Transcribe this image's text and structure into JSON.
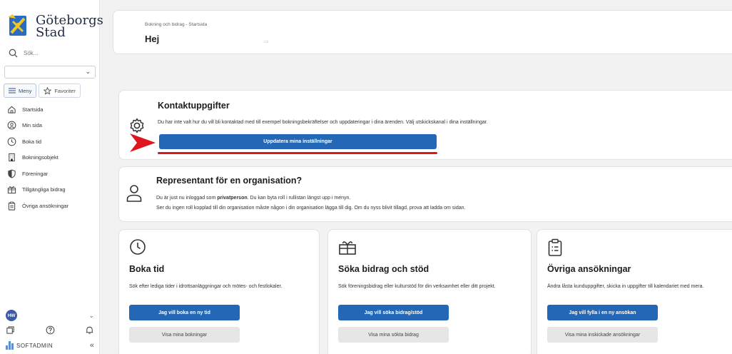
{
  "sidebar": {
    "logo_line1": "Göteborgs",
    "logo_line2": "Stad",
    "search_placeholder": "Sök...",
    "tabs": [
      {
        "label": "Meny",
        "icon": "menu-icon"
      },
      {
        "label": "Favoriter",
        "icon": "star-icon"
      }
    ],
    "items": [
      {
        "label": "Startsida",
        "icon": "home-icon"
      },
      {
        "label": "Min sida",
        "icon": "user-circle-icon"
      },
      {
        "label": "Boka tid",
        "icon": "clock-icon"
      },
      {
        "label": "Bokningsobjekt",
        "icon": "building-icon"
      },
      {
        "label": "Föreningar",
        "icon": "shield-icon"
      },
      {
        "label": "Tillgängliga bidrag",
        "icon": "gift-icon"
      },
      {
        "label": "Övriga ansökningar",
        "icon": "clipboard-icon"
      }
    ],
    "avatar_initials": "HW",
    "brand": "SOFTADMIN"
  },
  "header": {
    "breadcrumb": "Bokning och bidrag - Startsida",
    "greeting": "Hej"
  },
  "contact": {
    "title": "Kontaktuppgifter",
    "text": "Du har inte valt hur du vill bli kontaktad med till exempel bokningsbekräftelser och uppdateringar i dina ärenden. Välj utskickskanal i dina inställningar.",
    "button": "Uppdatera mina inställningar"
  },
  "representative": {
    "title": "Representant för en organisation?",
    "line1_a": "Du är just nu inloggad som ",
    "line1_bold": "privatperson",
    "line1_b": ". Du kan byta roll i rullistan längst upp i menyn.",
    "line2": "Ser du ingen roll kopplad till din organisation måste någon i din organisation lägga till dig. Om du nyss blivit tillagd, prova att ladda om sidan."
  },
  "tiles": [
    {
      "title": "Boka tid",
      "icon": "clock-icon",
      "desc": "Sök efter lediga tider i idrottsanläggningar och mötes- och festlokaler.",
      "primary": "Jag vill boka en ny tid",
      "secondary": "Visa mina bokningar"
    },
    {
      "title": "Söka bidrag och stöd",
      "icon": "gift-icon",
      "desc": "Sök föreningsbidrag eller kulturstöd för din verksamhet eller ditt projekt.",
      "primary": "Jag vill söka bidrag/stöd",
      "secondary": "Visa mina sökta bidrag"
    },
    {
      "title": "Övriga ansökningar",
      "icon": "clipboard-icon",
      "desc": "Ändra låsta kunduppgifter, skicka in uppgifter till kalendariet med mera.",
      "primary": "Jag vill fylla i en ny ansökan",
      "secondary": "Visa mina inskickade ansökningar"
    }
  ],
  "colors": {
    "primary": "#2467b6",
    "annotation": "#e0161e",
    "secondary_button": "#e6e6e6"
  }
}
